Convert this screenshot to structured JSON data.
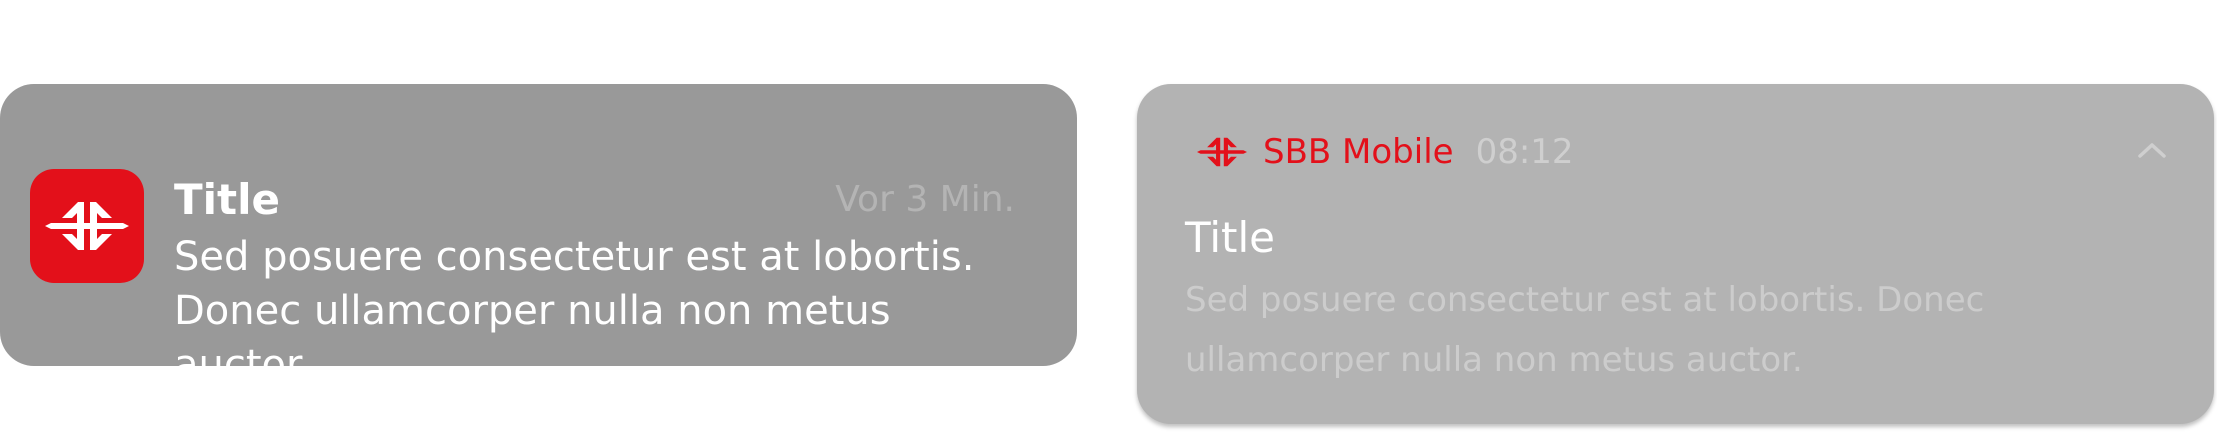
{
  "ios_notification": {
    "title": "Title",
    "time": "Vor 3 Min.",
    "body": "Sed posuere consectetur est at lobortis. Donec ullamcorper nulla non metus auctor.",
    "app_icon": "sbb-logo-icon"
  },
  "android_notification": {
    "app_name": "SBB Mobile",
    "time": "08:12",
    "title": "Title",
    "body": "Sed posuere consectetur est at lobortis. Donec ullamcorper nulla non metus auctor.",
    "app_icon": "sbb-logo-icon",
    "expand_icon": "chevron-up-icon"
  },
  "colors": {
    "sbb_red": "#e3101a",
    "ios_background": "#999999",
    "android_background": "#b3b3b3"
  }
}
